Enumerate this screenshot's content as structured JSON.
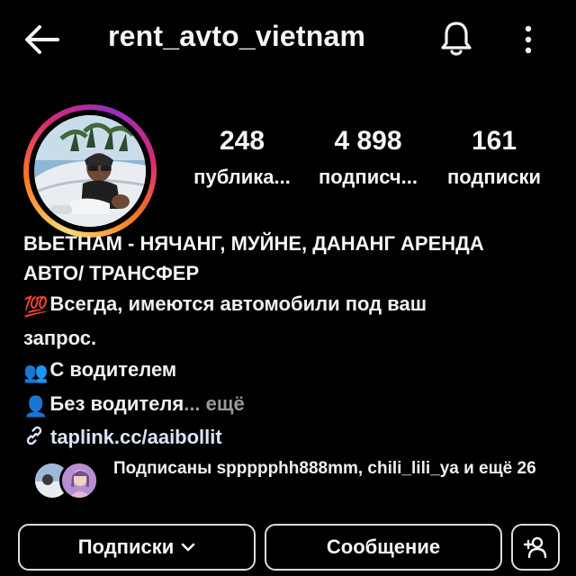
{
  "header": {
    "back_icon": "arrow-left-icon",
    "title": "rent_avto_vietnam",
    "bell_icon": "bell-icon",
    "more_icon": "more-vertical-icon"
  },
  "profile": {
    "avatar": "profile-photo",
    "stats": {
      "posts": {
        "value": "248",
        "label": "публика..."
      },
      "followers": {
        "value": "4 898",
        "label": "подписч..."
      },
      "following": {
        "value": "161",
        "label": "подписки"
      }
    }
  },
  "bio": {
    "title_line1": "ВЬЕТНАМ - НЯЧАНГ, МУЙНЕ, ДАНАНГ АРЕНДА",
    "title_line2": "АВТО/ ТРАНСФЕР",
    "line1": "Всегда, имеются автомобили под ваш",
    "line1_emoji": "💯",
    "line2": "запрос.",
    "line3": "С водителем",
    "line3_emoji": "👥",
    "line4": "Без водителя",
    "line4_emoji": "👤",
    "more": "... ещё",
    "link": "taplink.cc/aaibollit",
    "link_icon": "link-icon"
  },
  "mutual": {
    "text": "Подписаны sppppphh888mm, chili_lili_ya и ещё 26"
  },
  "buttons": {
    "following": "Подписки",
    "message": "Сообщение",
    "add_user_icon": "add-user-icon"
  },
  "colors": {
    "background": "#000000",
    "text": "#f5f5f5",
    "muted": "#9a9a9a",
    "link": "#d9e4f7",
    "button_border": "#dcdcdc"
  }
}
